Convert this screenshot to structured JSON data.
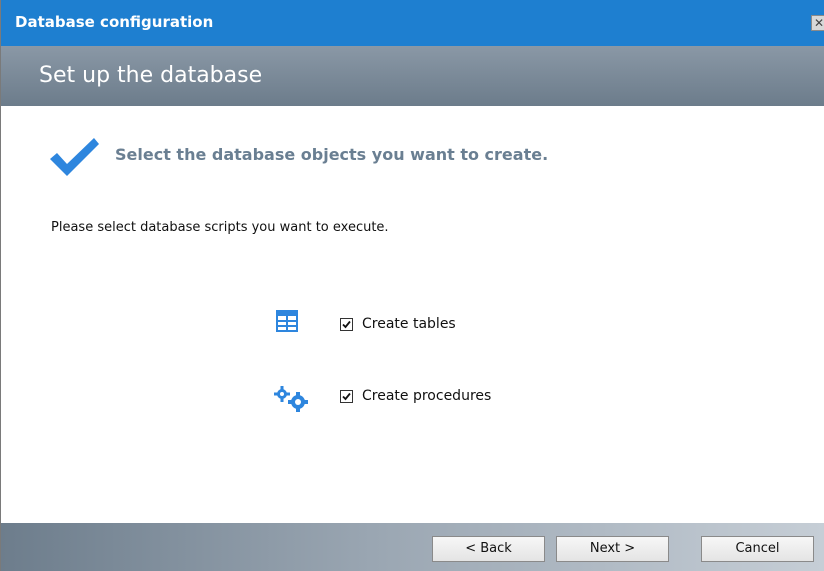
{
  "window": {
    "title": "Database configuration",
    "close_glyph": "✕"
  },
  "header": {
    "title": "Set up the database"
  },
  "main": {
    "heading": "Select the database objects you want to create.",
    "instruction": "Please select database scripts you want to execute.",
    "options": [
      {
        "label": "Create tables",
        "checked": true,
        "icon": "table-icon"
      },
      {
        "label": "Create procedures",
        "checked": true,
        "icon": "gears-icon"
      }
    ]
  },
  "footer": {
    "back_label": "< Back",
    "next_label": "Next >",
    "cancel_label": "Cancel"
  },
  "colors": {
    "titlebar": "#1e7fd0",
    "accent": "#2e86de",
    "heading_text": "#6a7f92"
  }
}
